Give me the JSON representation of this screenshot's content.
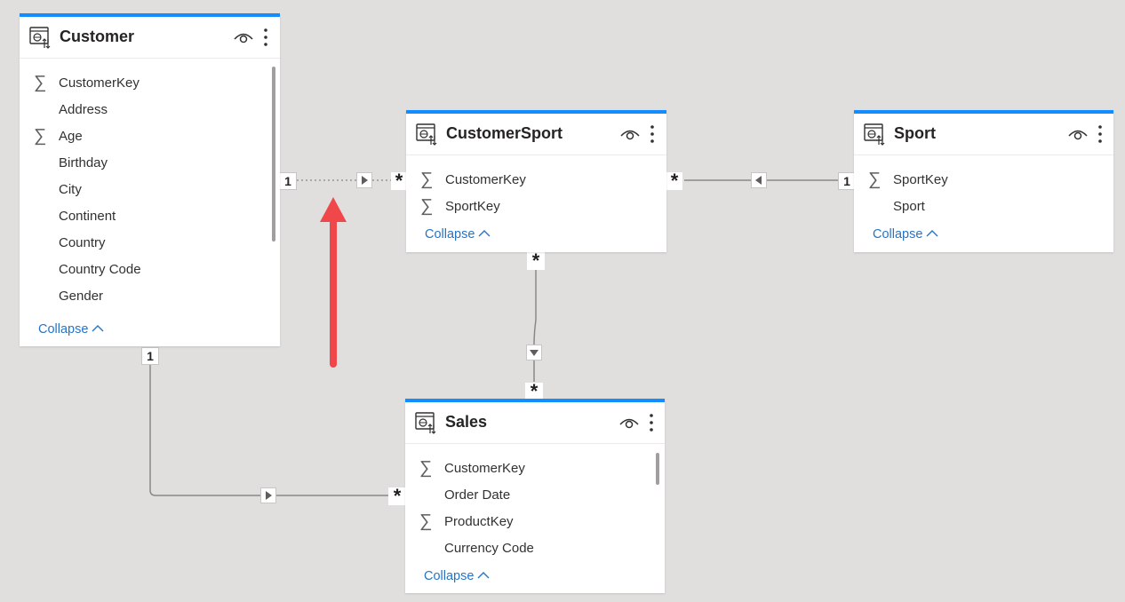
{
  "tables": {
    "customer": {
      "title": "Customer",
      "fields": [
        {
          "label": "CustomerKey",
          "sigma": true
        },
        {
          "label": "Address",
          "sigma": false
        },
        {
          "label": "Age",
          "sigma": true
        },
        {
          "label": "Birthday",
          "sigma": false
        },
        {
          "label": "City",
          "sigma": false
        },
        {
          "label": "Continent",
          "sigma": false
        },
        {
          "label": "Country",
          "sigma": false
        },
        {
          "label": "Country Code",
          "sigma": false
        },
        {
          "label": "Gender",
          "sigma": false
        }
      ],
      "collapse_label": "Collapse"
    },
    "customersport": {
      "title": "CustomerSport",
      "fields": [
        {
          "label": "CustomerKey",
          "sigma": true
        },
        {
          "label": "SportKey",
          "sigma": true
        }
      ],
      "collapse_label": "Collapse"
    },
    "sport": {
      "title": "Sport",
      "fields": [
        {
          "label": "SportKey",
          "sigma": true
        },
        {
          "label": "Sport",
          "sigma": false
        }
      ],
      "collapse_label": "Collapse"
    },
    "sales": {
      "title": "Sales",
      "fields": [
        {
          "label": "CustomerKey",
          "sigma": true
        },
        {
          "label": "Order Date",
          "sigma": false
        },
        {
          "label": "ProductKey",
          "sigma": true
        },
        {
          "label": "Currency Code",
          "sigma": false
        }
      ],
      "collapse_label": "Collapse"
    }
  },
  "relationships": {
    "one_label": "1",
    "many_label": "*"
  },
  "icons": {
    "sum": "∑",
    "chevron_up": "^",
    "more": "⋮"
  },
  "colors": {
    "accent": "#118dff",
    "canvas": "#e1dfdd",
    "link": "#2774c5",
    "arrow": "#f0484a"
  }
}
